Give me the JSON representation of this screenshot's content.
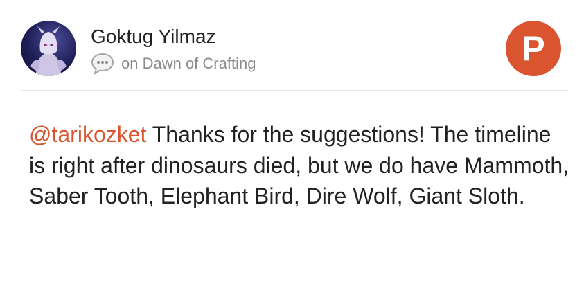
{
  "post": {
    "author": "Goktug Yilmaz",
    "source": "on Dawn of Crafting",
    "comment_icon": "speech-bubble-icon",
    "brand_logo_letter": "P",
    "brand_color": "#da552f",
    "mention": "@tarikozket",
    "body": " Thanks for the suggestions! The timeline is right after dinosaurs died, but we do have Mammoth, Saber Tooth, Elephant Bird, Dire Wolf, Giant Sloth."
  }
}
